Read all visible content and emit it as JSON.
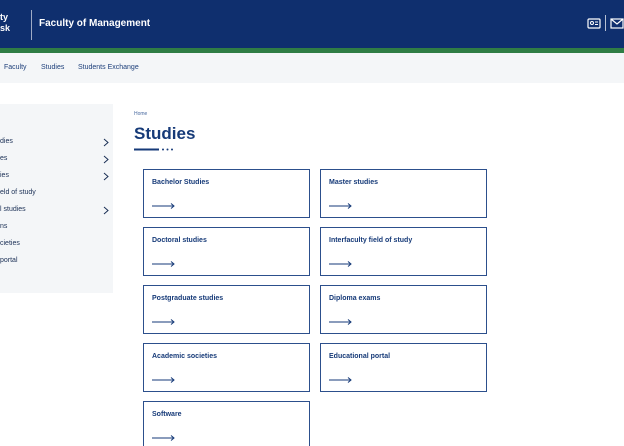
{
  "header": {
    "logo_line1": "ty",
    "logo_line2": "sk",
    "faculty_name": "Faculty of Management",
    "icons": [
      "id-card-icon",
      "mail-icon"
    ]
  },
  "subnav": {
    "items": [
      "Faculty",
      "Studies",
      "Students Exchange"
    ]
  },
  "sidebar": {
    "items": [
      {
        "label": "dies",
        "has_chevron": true
      },
      {
        "label": "es",
        "has_chevron": true
      },
      {
        "label": "ies",
        "has_chevron": true
      },
      {
        "label": "eld of study",
        "has_chevron": false
      },
      {
        "label": "l studies",
        "has_chevron": true
      },
      {
        "label": "ns",
        "has_chevron": false
      },
      {
        "label": "cieties",
        "has_chevron": false
      },
      {
        "label": "portal",
        "has_chevron": false
      }
    ]
  },
  "main": {
    "breadcrumb": "Home",
    "title": "Studies",
    "cards": [
      "Bachelor Studies",
      "Master studies",
      "Doctoral studies",
      "Interfaculty field of study",
      "Postgraduate studies",
      "Diploma exams",
      "Academic societies",
      "Educational portal",
      "Software"
    ]
  },
  "colors": {
    "header_bg": "#0f2f6e",
    "accent_green": "#2f7d45",
    "text_primary": "#163a78",
    "panel_bg": "#f4f6f8",
    "card_border": "#2c4f8c"
  }
}
